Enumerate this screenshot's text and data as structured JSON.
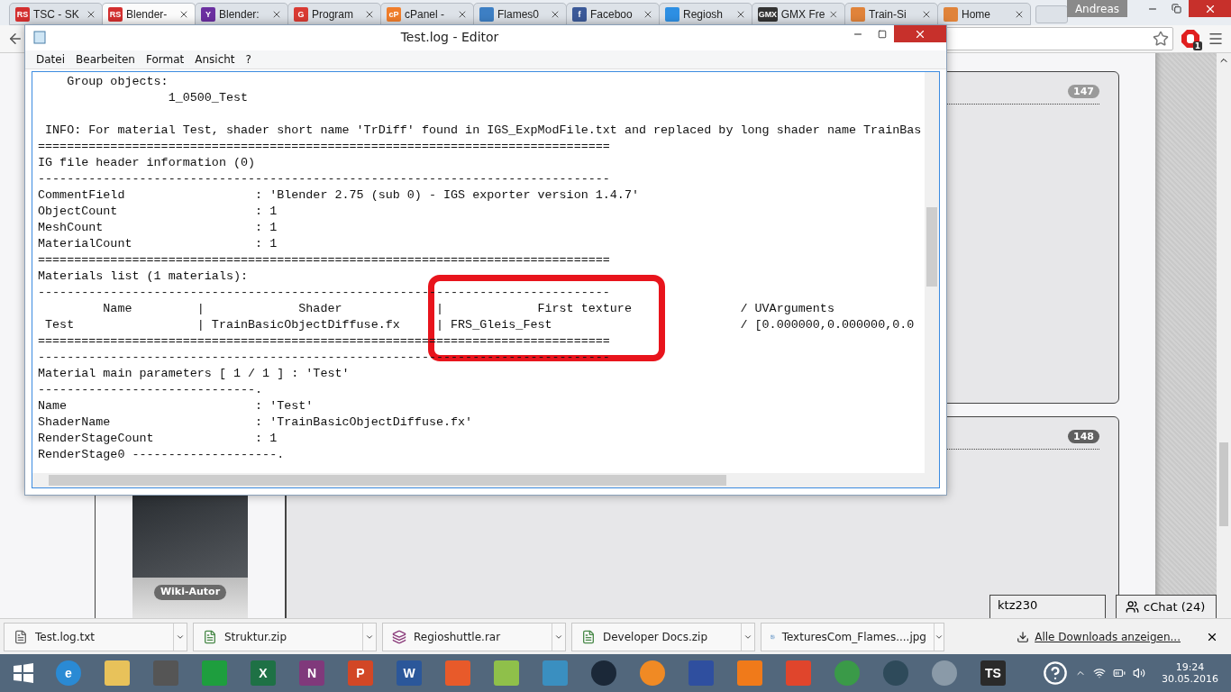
{
  "browser": {
    "tabs": [
      {
        "title": "TSC - SK",
        "icon": "RS",
        "color": "#d32f2f",
        "selected": false
      },
      {
        "title": "Blender-",
        "icon": "RS",
        "color": "#d32f2f",
        "selected": true
      },
      {
        "title": "Blender:",
        "icon": "Y",
        "color": "#6b2fa0",
        "selected": false
      },
      {
        "title": "Program",
        "icon": "G",
        "color": "#d93a33",
        "selected": false
      },
      {
        "title": "cPanel -",
        "icon": "cP",
        "color": "#f07d2a",
        "selected": false
      },
      {
        "title": "Flames0",
        "color": "#3d7fc4",
        "selected": false
      },
      {
        "title": "Faceboo",
        "icon": "f",
        "color": "#3b5998",
        "selected": false
      },
      {
        "title": "Regiosh",
        "color": "#2d8fe3",
        "selected": false
      },
      {
        "title": "GMX Fre",
        "icon": "GMX",
        "color": "#333333",
        "selected": false
      },
      {
        "title": "Train-Si",
        "color": "#e0833a",
        "selected": false
      },
      {
        "title": "Home",
        "color": "#e0833a",
        "selected": false
      }
    ],
    "user": "Andreas",
    "adblock_count": "1"
  },
  "page": {
    "posts": [
      {
        "count": "147"
      },
      {
        "count": "148",
        "rank": "Wiki-Autor"
      }
    ],
    "chat": {
      "user": "ktz230",
      "label": "cChat (24)"
    }
  },
  "editor": {
    "title": "Test.log - Editor",
    "menu": [
      "Datei",
      "Bearbeiten",
      "Format",
      "Ansicht",
      "?"
    ],
    "content": "    Group objects:\n                  1_0500_Test\n\n INFO: For material Test, shader short name 'TrDiff' found in IGS_ExpModFile.txt and replaced by long shader name TrainBas\n===============================================================================\nIG file header information (0)\n-------------------------------------------------------------------------------\nCommentField                  : 'Blender 2.75 (sub 0) - IGS exporter version 1.4.7'\nObjectCount                   : 1\nMeshCount                     : 1\nMaterialCount                 : 1\n===============================================================================\nMaterials list (1 materials):\n-------------------------------------------------------------------------------\n         Name         |             Shader             |             First texture               / UVArguments\n Test                 | TrainBasicObjectDiffuse.fx     | FRS_Gleis_Fest                          / [0.000000,0.000000,0.0\n===============================================================================\n-------------------------------------------------------------------------------\nMaterial main parameters [ 1 / 1 ] : 'Test'\n------------------------------.\nName                          : 'Test'\nShaderName                    : 'TrainBasicObjectDiffuse.fx'\nRenderStageCount              : 1\nRenderStage0 --------------------."
  },
  "downloads": {
    "items": [
      {
        "name": "Test.log.txt",
        "kind": "text"
      },
      {
        "name": "Struktur.zip",
        "kind": "zip"
      },
      {
        "name": "Regioshuttle.rar",
        "kind": "rar"
      },
      {
        "name": "Developer Docs.zip",
        "kind": "zip"
      },
      {
        "name": "TexturesCom_Flames....jpg",
        "kind": "image"
      }
    ],
    "show_all": "Alle Downloads anzeigen..."
  },
  "taskbar": {
    "apps": [
      {
        "kind": "browser",
        "color": "#2a8ad4",
        "letter": "e"
      },
      {
        "kind": "folder",
        "color": "#e8c25a"
      },
      {
        "kind": "speaker",
        "color": "#555555"
      },
      {
        "kind": "store",
        "color": "#1e9e3e"
      },
      {
        "kind": "office",
        "color": "#1e7145",
        "letter": "X"
      },
      {
        "kind": "office",
        "color": "#80397b",
        "letter": "N"
      },
      {
        "kind": "office",
        "color": "#d24726",
        "letter": "P"
      },
      {
        "kind": "office",
        "color": "#2b579a",
        "letter": "W"
      },
      {
        "kind": "tiles",
        "color": "#e85a2a"
      },
      {
        "kind": "editor",
        "color": "#8fc04a"
      },
      {
        "kind": "photo",
        "color": "#3a8fc0"
      },
      {
        "kind": "round",
        "color": "#1b2838"
      },
      {
        "kind": "round",
        "color": "#f08a24"
      },
      {
        "kind": "paint",
        "color": "#2f4f9f"
      },
      {
        "kind": "player",
        "color": "#f07a1a"
      },
      {
        "kind": "office",
        "color": "#e0452c"
      },
      {
        "kind": "round",
        "color": "#3a9a48"
      },
      {
        "kind": "round",
        "color": "#2e4a5a"
      },
      {
        "kind": "round",
        "color": "#8a9aa8"
      },
      {
        "kind": "office",
        "color": "#2a2a2a",
        "letter": "TS"
      }
    ],
    "time": "19:24",
    "date": "30.05.2016"
  }
}
